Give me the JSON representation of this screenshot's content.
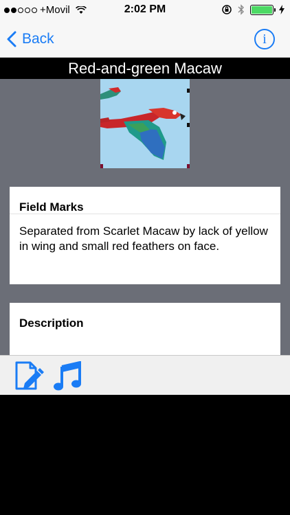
{
  "status_bar": {
    "carrier": "+Movil",
    "time": "2:02 PM",
    "signal_bars_filled": 2,
    "signal_bars_total": 5,
    "battery_level": 1.0,
    "icons": [
      "wifi-icon",
      "orientation-lock-icon",
      "bluetooth-icon",
      "battery-icon",
      "charging-icon"
    ]
  },
  "nav": {
    "back_label": "Back",
    "info_label": "i"
  },
  "page_title": "Red-and-green Macaw",
  "image": {
    "subject": "red-and-green-macaw-photo"
  },
  "cards": {
    "field_marks": {
      "title": "Field Marks",
      "body": "Separated from Scarlet Macaw by lack of yellow in wing and small red feathers on face."
    },
    "description": {
      "title": "Description"
    }
  },
  "toolbar": {
    "items": [
      "notes-edit-icon",
      "music-icon"
    ]
  },
  "colors": {
    "accent": "#1a7cf5",
    "content_bg": "#6b6e77",
    "title_bar_bg": "#000000",
    "battery": "#4cd964"
  }
}
